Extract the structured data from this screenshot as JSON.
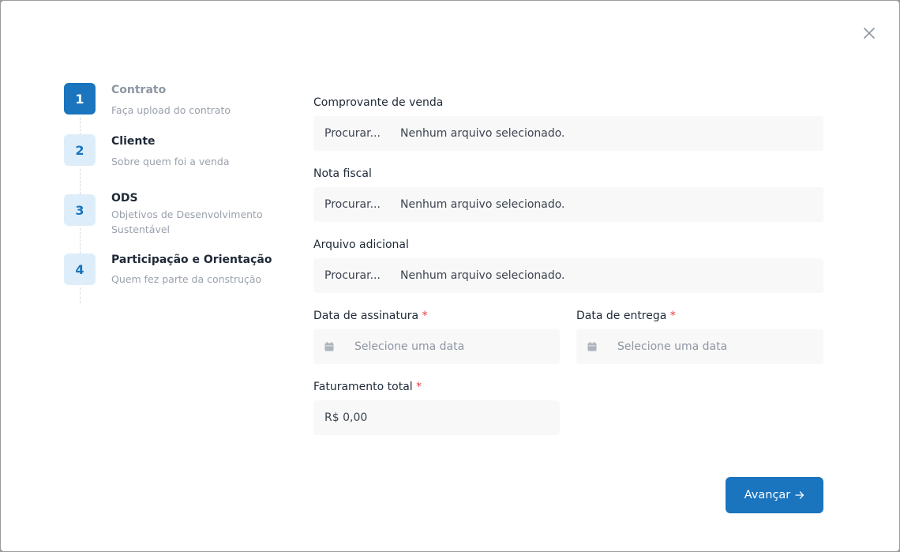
{
  "steps": [
    {
      "number": "1",
      "title": "Contrato",
      "description": "Faça upload do contrato"
    },
    {
      "number": "2",
      "title": "Cliente",
      "description": "Sobre quem foi a venda"
    },
    {
      "number": "3",
      "title": "ODS",
      "description": "Objetivos de Desenvolvimento Sustentável"
    },
    {
      "number": "4",
      "title": "Participação e Orientação",
      "description": "Quem fez parte da construção"
    }
  ],
  "form": {
    "comprovante": {
      "label": "Comprovante de venda",
      "button": "Procurar...",
      "status": "Nenhum arquivo selecionado."
    },
    "nota_fiscal": {
      "label": "Nota fiscal",
      "button": "Procurar...",
      "status": "Nenhum arquivo selecionado."
    },
    "arquivo_adicional": {
      "label": "Arquivo adicional",
      "button": "Procurar...",
      "status": "Nenhum arquivo selecionado."
    },
    "data_assinatura": {
      "label": "Data de assinatura",
      "required_mark": "*",
      "placeholder": "Selecione uma data"
    },
    "data_entrega": {
      "label": "Data de entrega",
      "required_mark": "*",
      "placeholder": "Selecione uma data"
    },
    "faturamento": {
      "label": "Faturamento total",
      "required_mark": "*",
      "value": "R$ 0,00"
    }
  },
  "actions": {
    "next_label": "Avançar"
  },
  "icons": {
    "close": "close-icon",
    "calendar": "calendar-icon",
    "arrow": "arrow-right-icon"
  },
  "colors": {
    "primary": "#1a74be",
    "primary_light": "#ddeefa",
    "required": "#e53e3e"
  }
}
